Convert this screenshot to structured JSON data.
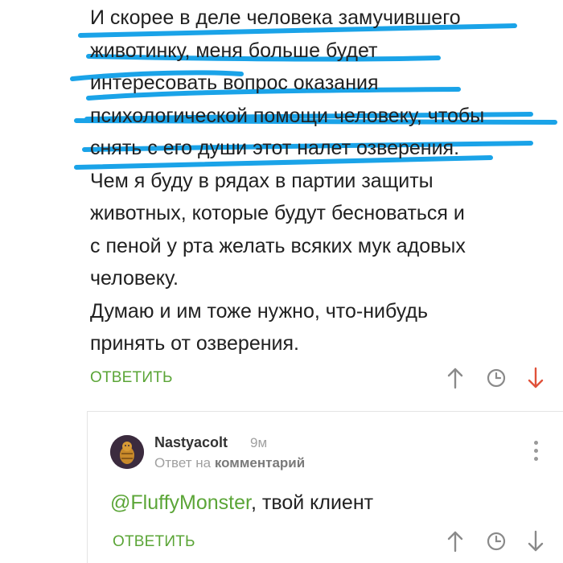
{
  "comment": {
    "lines": [
      "И скорее в деле человека замучившего",
      "животинку, меня больше будет",
      "интересовать вопрос оказания",
      "психологической помощи человеку, чтобы",
      "снять с его души этот налет озверения.",
      "Чем я буду в рядах в партии защиты",
      "животных, которые будут бесноваться и",
      "с пеной у рта желать всяких мук адовых",
      "человеку.",
      "Думаю и им тоже нужно, что-нибудь",
      "принять от озверения."
    ],
    "reply_label": "ОТВЕТИТЬ"
  },
  "reply": {
    "author": "Nastyacolt",
    "time": "9м",
    "reply_to_prefix": "Ответ на",
    "reply_to_target": "комментарий",
    "mention": "@FluffyMonster",
    "text": ", твой клиент",
    "reply_label": "ОТВЕТИТЬ"
  },
  "icons": {
    "upvote": "arrow-up-icon",
    "save": "clock-icon",
    "downvote": "arrow-down-icon",
    "more": "more-vertical-icon"
  },
  "colors": {
    "accent_green": "#5ba537",
    "downvote_active": "#e0523a",
    "highlight_blue": "#1aa3e8"
  }
}
